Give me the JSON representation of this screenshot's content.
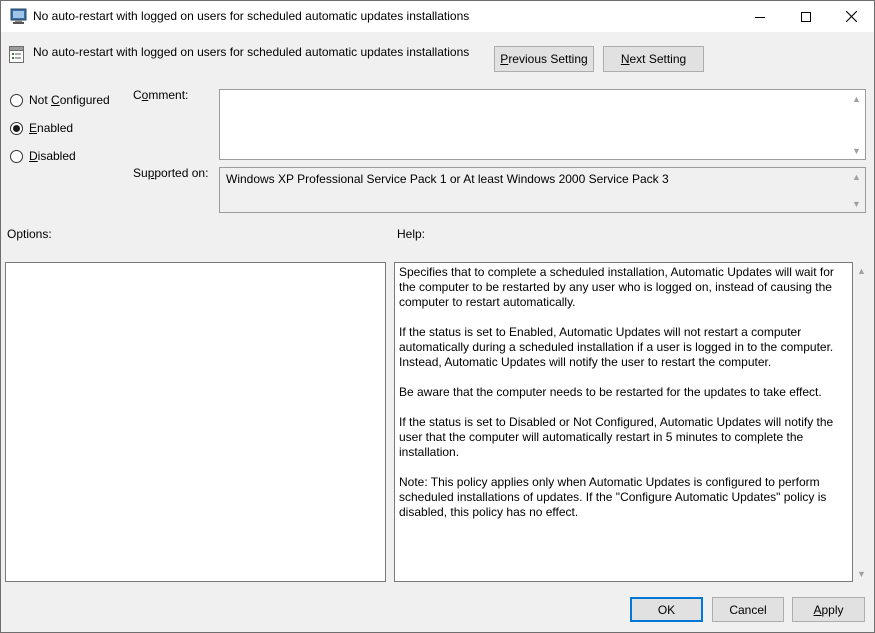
{
  "window": {
    "title": "No auto-restart with logged on users for scheduled automatic updates installations",
    "icon": "policy-editor-icon"
  },
  "header": {
    "policy_name": "No auto-restart with logged on users for scheduled automatic updates installations",
    "prev_button": {
      "prefix": "",
      "accel": "P",
      "rest": "revious Setting"
    },
    "next_button": {
      "prefix": "",
      "accel": "N",
      "rest": "ext Setting"
    }
  },
  "state_options": [
    {
      "prefix": "Not ",
      "accel": "C",
      "rest": "onfigured",
      "checked": false
    },
    {
      "prefix": "",
      "accel": "E",
      "rest": "nabled",
      "checked": true
    },
    {
      "prefix": "",
      "accel": "D",
      "rest": "isabled",
      "checked": false
    }
  ],
  "labels": {
    "comment": {
      "prefix": "C",
      "accel": "o",
      "rest": "mment:"
    },
    "supported_on": {
      "prefix": "Su",
      "accel": "p",
      "rest": "ported on:"
    },
    "options": "Options:",
    "help": "Help:"
  },
  "comment_value": "",
  "supported_on_value": "Windows XP Professional Service Pack 1 or At least Windows 2000 Service Pack 3",
  "help_paragraphs": [
    "Specifies that to complete a scheduled installation, Automatic Updates will wait for the computer to be restarted by any user who is logged on, instead of causing the computer to restart automatically.",
    "If the status is set to Enabled, Automatic Updates will not restart a computer automatically during a scheduled installation if a user is logged in to the computer. Instead, Automatic Updates will notify the user to restart the computer.",
    "Be aware that the computer needs to be restarted for the updates to take effect.",
    "If the status is set to Disabled or Not Configured, Automatic Updates will notify the user that the computer will automatically restart in 5 minutes to complete the installation.",
    "Note: This policy applies only when Automatic Updates is configured to perform scheduled installations of updates. If the \"Configure Automatic Updates\" policy is disabled, this policy has no effect."
  ],
  "footer": {
    "ok": "OK",
    "cancel": "Cancel",
    "apply": {
      "prefix": "",
      "accel": "A",
      "rest": "pply"
    }
  },
  "colors": {
    "window_bg": "#f0f0f0",
    "default_button_border": "#0078d7"
  }
}
